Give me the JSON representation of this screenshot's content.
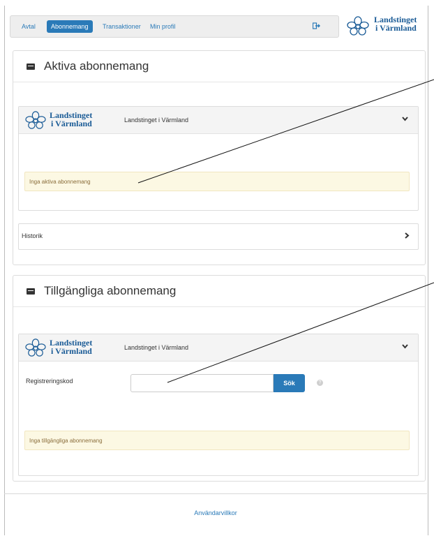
{
  "nav": {
    "items": [
      "Avtal",
      "Abonnemang",
      "Transaktioner",
      "Min profil"
    ],
    "active_index": 1
  },
  "brand": {
    "line1": "Landstinget",
    "line2": "i Värmland"
  },
  "active_panel": {
    "title": "Aktiva abonnemang",
    "provider_logo": {
      "line1": "Landstinget",
      "line2": "i Värmland"
    },
    "provider_name": "Landstinget i Värmland",
    "notice": "Inga aktiva abonnemang",
    "history_label": "Historik"
  },
  "available_panel": {
    "title": "Tillgängliga abonnemang",
    "provider_logo": {
      "line1": "Landstinget",
      "line2": "i Värmland"
    },
    "provider_name": "Landstinget i Värmland",
    "reg_label": "Registreringskod",
    "reg_value": "",
    "search_button": "Sök",
    "notice": "Inga tillgängliga abonnemang"
  },
  "footer": {
    "link": "Användarvillkor"
  },
  "icons": {
    "logout": "sign-out-icon",
    "panel": "credit-card-icon",
    "expand": "chevron-down-icon",
    "history": "chevron-right-icon",
    "help": "question-circle-icon",
    "logo": "flower-logo-icon"
  },
  "colors": {
    "accent": "#2a7ab8",
    "brand": "#1a5b96",
    "notice_bg": "#fcf8e3"
  }
}
